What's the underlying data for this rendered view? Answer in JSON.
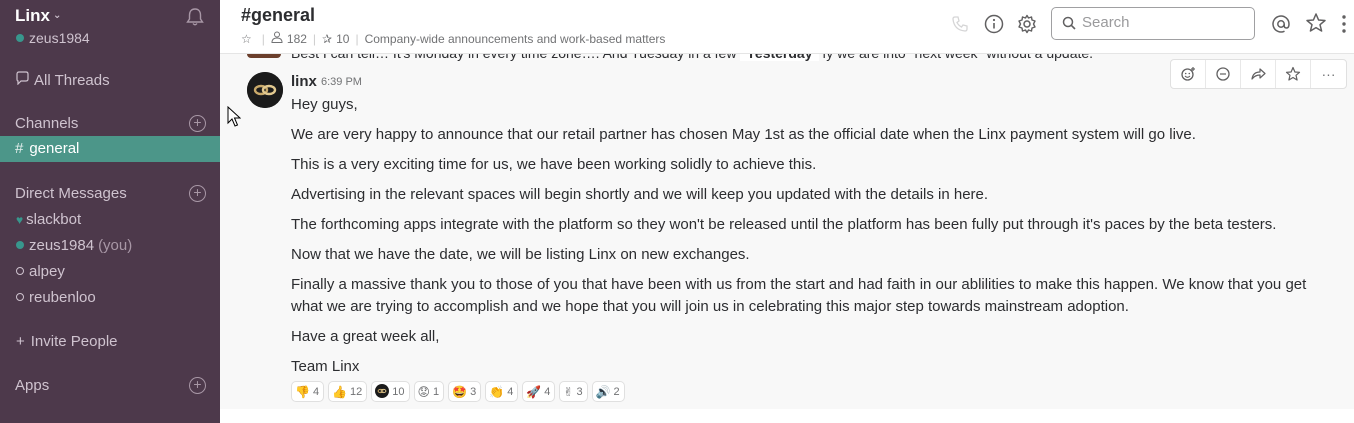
{
  "sidebar": {
    "team_name": "Linx",
    "username": "zeus1984",
    "all_threads": "All Threads",
    "channels_heading": "Channels",
    "active_channel": "general",
    "dm_heading": "Direct Messages",
    "dms": [
      {
        "name": "slackbot",
        "status": "bot",
        "suffix": ""
      },
      {
        "name": "zeus1984",
        "status": "online",
        "suffix": "(you)"
      },
      {
        "name": "alpey",
        "status": "offline",
        "suffix": ""
      },
      {
        "name": "reubenloo",
        "status": "offline",
        "suffix": ""
      }
    ],
    "invite": "Invite People",
    "apps": "Apps"
  },
  "header": {
    "channel": "#general",
    "members": "182",
    "pinned": "10",
    "topic": "Company-wide announcements and work-based matters",
    "search_placeholder": "Search"
  },
  "previous_message": {
    "text_before": "Best I can tell… It's Monday in every time zone…. And Tuesday in a few",
    "day_divider": "Yesterday",
    "text_after": "fy we are into \"next week\" without a update."
  },
  "message": {
    "author": "linx",
    "time": "6:39 PM",
    "paragraphs": [
      "Hey guys,",
      "We are very happy to announce that our retail partner has chosen May 1st as the official date when the Linx payment system will go live.",
      "This is a very exciting time for us, we have been working solidly to achieve this.",
      "Advertising in the relevant spaces will begin shortly and we will keep you updated with the details in here.",
      "The forthcoming apps integrate with the platform so they won't be released until the platform has been fully put through it's paces by the beta testers.",
      "Now that we have the date, we will be listing Linx on new exchanges.",
      "Finally a massive thank you to those of you that have been with us from the start and had faith in our ablilities to make this happen. We know that you get what we are trying to accomplish and we hope that you will join us in celebrating this major step towards mainstream adoption.",
      "Have a great week all,",
      "Team Linx"
    ],
    "reactions": [
      {
        "emoji": "👎",
        "count": "4"
      },
      {
        "emoji": "👍",
        "count": "12"
      },
      {
        "emoji": "linx-logo",
        "count": "10"
      },
      {
        "emoji": "😟",
        "count": "1"
      },
      {
        "emoji": "🤩",
        "count": "3"
      },
      {
        "emoji": "👏",
        "count": "4"
      },
      {
        "emoji": "🚀",
        "count": "4"
      },
      {
        "emoji": "✌",
        "count": "3"
      },
      {
        "emoji": "🔊",
        "count": "2"
      }
    ]
  },
  "colors": {
    "sidebar_bg": "#4d394b",
    "active_channel_bg": "#4c9689",
    "presence_green": "#38978d"
  }
}
